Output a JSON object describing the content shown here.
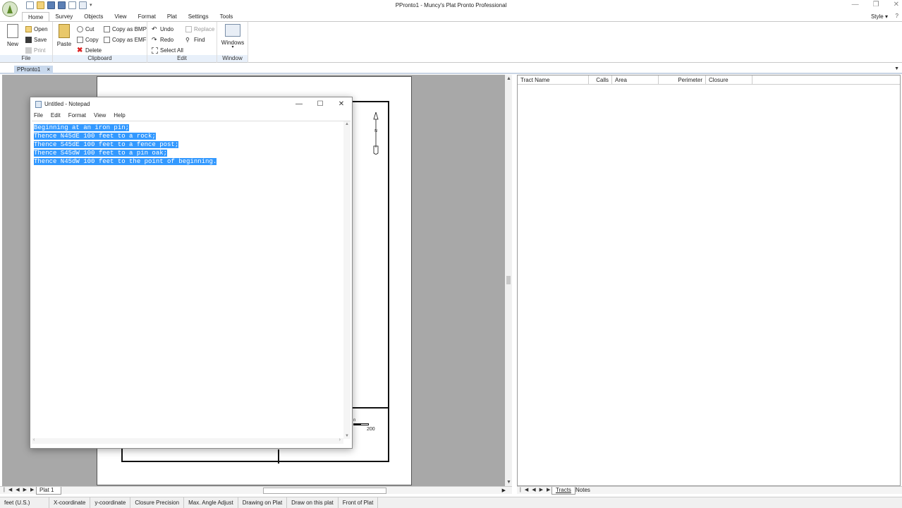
{
  "app": {
    "title": "PPronto1 - Muncy's Plat Pronto Professional",
    "style_label": "Style"
  },
  "ribbon": {
    "tabs": [
      "Home",
      "Survey",
      "Objects",
      "View",
      "Format",
      "Plat",
      "Settings",
      "Tools"
    ],
    "file": {
      "label": "File",
      "new": "New",
      "open": "Open",
      "save": "Save",
      "print": "Print"
    },
    "clipboard": {
      "label": "Clipboard",
      "paste": "Paste",
      "cut": "Cut",
      "copy": "Copy",
      "delete": "Delete",
      "copy_bmp": "Copy as BMP",
      "copy_emf": "Copy as EMF"
    },
    "edit": {
      "label": "Edit",
      "undo": "Undo",
      "redo": "Redo",
      "select_all": "Select All",
      "replace": "Replace",
      "find": "Find"
    },
    "window": {
      "label": "Window",
      "windows": "Windows"
    }
  },
  "doc_tab": {
    "label": "PPronto1",
    "close": "×"
  },
  "plat": {
    "scale_value": "200",
    "north_label": "N",
    "scale_n": "n"
  },
  "sheet_tabs": {
    "plat": "Plat 1"
  },
  "tract_grid": {
    "columns": [
      "Tract Name",
      "Calls",
      "Area",
      "Perimeter",
      "Closure"
    ]
  },
  "right_tabs": {
    "tracts": "Tracts",
    "notes": "Notes"
  },
  "status_bar": [
    "feet (U.S.)",
    "X-coordinate",
    "y-coordinate",
    "Closure Precision",
    "Max. Angle Adjust",
    "Drawing on Plat",
    "Draw on this plat",
    "Front of Plat"
  ],
  "notepad": {
    "title": "Untitled - Notepad",
    "menu": [
      "File",
      "Edit",
      "Format",
      "View",
      "Help"
    ],
    "lines": [
      "Beginning at an iron pin;",
      "Thence N45dE 100 feet to a rock;",
      "Thence S45dE 100 feet to a fence post;",
      "Thence S45dW 100 feet to a pin oak;",
      "Thence N45dW 100 feet to the point of beginning."
    ],
    "selection_color": "#3399ff"
  }
}
